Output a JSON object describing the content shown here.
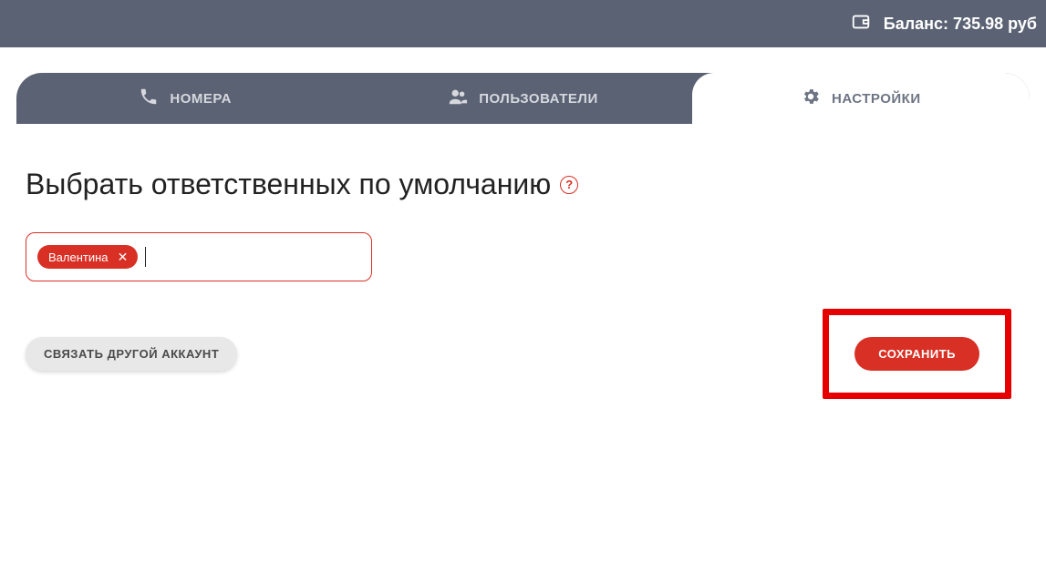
{
  "header": {
    "balance": "Баланс: 735.98 руб"
  },
  "tabs": {
    "numbers": "НОМЕРА",
    "users": "ПОЛЬЗОВАТЕЛИ",
    "settings": "НАСТРОЙКИ"
  },
  "page": {
    "title": "Выбрать ответственных по умолчанию",
    "help": "?"
  },
  "responsibles": {
    "tags": [
      {
        "label": "Валентина"
      }
    ]
  },
  "actions": {
    "link_other": "СВЯЗАТЬ ДРУГОЙ АККАУНТ",
    "save": "СОХРАНИТЬ"
  }
}
